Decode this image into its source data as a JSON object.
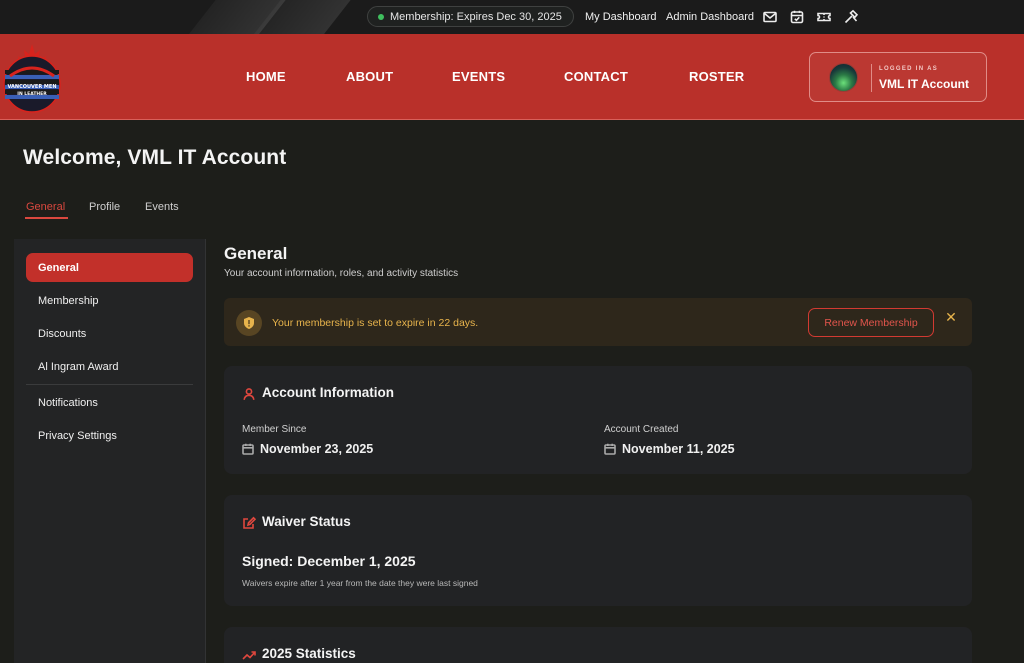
{
  "topbar": {
    "membership_status": "Membership: Expires Dec 30, 2025",
    "links": [
      "My Dashboard",
      "Admin Dashboard"
    ],
    "icons": [
      "mail-icon",
      "calendar-check-icon",
      "ticket-icon",
      "hammer-icon"
    ]
  },
  "header": {
    "logo_text_line1": "VANCOUVER MEN",
    "logo_text_line2": "IN LEATHER",
    "nav": [
      "HOME",
      "ABOUT",
      "EVENTS",
      "CONTACT",
      "ROSTER"
    ],
    "account": {
      "logged_in_label": "LOGGED IN AS",
      "name": "VML IT Account"
    }
  },
  "welcome": "Welcome, VML IT Account",
  "tabs": [
    "General",
    "Profile",
    "Events"
  ],
  "active_tab": "General",
  "sidebar": {
    "items": [
      "General",
      "Membership",
      "Discounts",
      "Al Ingram Award",
      "Notifications",
      "Privacy Settings"
    ],
    "active": "General"
  },
  "main": {
    "title": "General",
    "subtitle": "Your account information, roles, and activity statistics",
    "alert": {
      "message": "Your membership is set to expire in 22 days.",
      "button": "Renew Membership"
    },
    "account_info": {
      "title": "Account Information",
      "member_since_label": "Member Since",
      "member_since_value": "November 23, 2025",
      "created_label": "Account Created",
      "created_value": "November 11, 2025"
    },
    "waiver": {
      "title": "Waiver Status",
      "signed": "Signed: December 1, 2025",
      "note": "Waivers expire after 1 year from the date they were last signed"
    },
    "statistics": {
      "title": "2025 Statistics"
    }
  },
  "colors": {
    "brand_red": "#b9302a",
    "accent_red": "#d9483f",
    "warning_amber": "#e8b44c",
    "status_green": "#3fbf5e"
  }
}
